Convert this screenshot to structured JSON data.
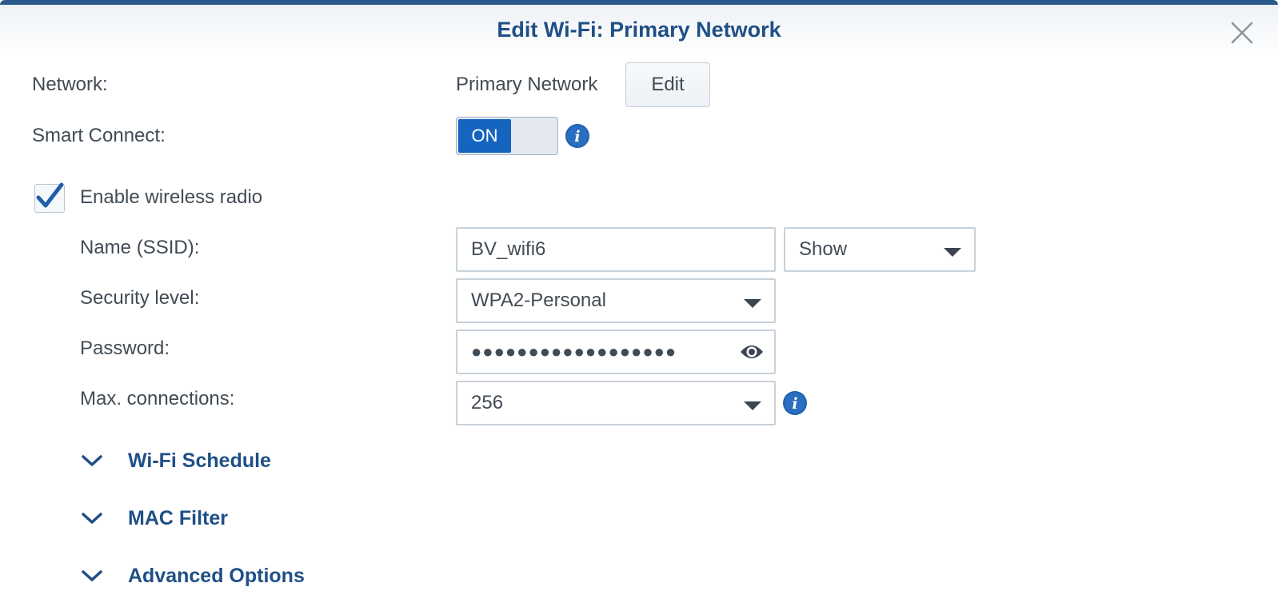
{
  "dialog": {
    "title": "Edit Wi-Fi: Primary Network",
    "close_icon": "close-icon"
  },
  "network": {
    "label": "Network:",
    "value": "Primary Network",
    "edit_label": "Edit"
  },
  "smart_connect": {
    "label": "Smart Connect:",
    "toggle_label": "ON",
    "state": true,
    "info_icon": "info-icon"
  },
  "wireless_radio": {
    "label": "Enable wireless radio",
    "checked": true
  },
  "ssid": {
    "label": "Name (SSID):",
    "value": "BV_wifi6",
    "visibility_value": "Show"
  },
  "security": {
    "label": "Security level:",
    "value": "WPA2-Personal"
  },
  "password": {
    "label": "Password:",
    "masked_value": "●●●●●●●●●●●●●●●●●●",
    "eye_icon": "eye-icon"
  },
  "max_connections": {
    "label": "Max. connections:",
    "value": "256",
    "info_icon": "info-icon"
  },
  "sections": [
    {
      "label": "Wi-Fi Schedule",
      "icon": "chevron-down-icon"
    },
    {
      "label": "MAC Filter",
      "icon": "chevron-down-icon"
    },
    {
      "label": "Advanced Options",
      "icon": "chevron-down-icon"
    }
  ],
  "colors": {
    "accent": "#1565c0",
    "title": "#1f4f86",
    "text": "#414b55",
    "topbar": "#2b5a8c"
  }
}
